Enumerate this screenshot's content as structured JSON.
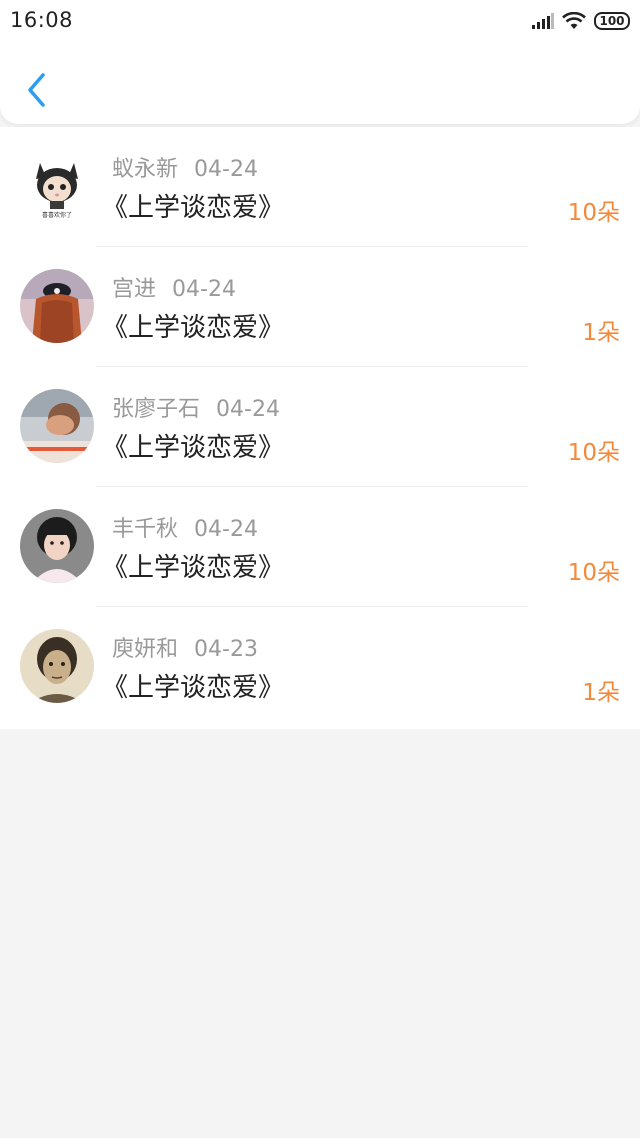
{
  "status_bar": {
    "time": "16:08",
    "battery": "100"
  },
  "nav": {
    "back_icon": "chevron-left-icon",
    "accent_color": "#2a9ff0"
  },
  "list": {
    "items": [
      {
        "name": "蚁永新",
        "date": "04-24",
        "title": "《上学谈恋爱》",
        "amount": "10朵",
        "avatar": "cartoon-cat-girl"
      },
      {
        "name": "宫进",
        "date": "04-24",
        "title": "《上学谈恋爱》",
        "amount": "1朵",
        "avatar": "girl-with-cap"
      },
      {
        "name": "张廖子石",
        "date": "04-24",
        "title": "《上学谈恋爱》",
        "amount": "10朵",
        "avatar": "hand-over-face"
      },
      {
        "name": "丰千秋",
        "date": "04-24",
        "title": "《上学谈恋爱》",
        "amount": "10朵",
        "avatar": "child-portrait"
      },
      {
        "name": "庾妍和",
        "date": "04-23",
        "title": "《上学谈恋爱》",
        "amount": "1朵",
        "avatar": "sepia-portrait"
      }
    ]
  },
  "colors": {
    "amount": "#f28a3c",
    "name": "#999999",
    "title": "#222222"
  }
}
